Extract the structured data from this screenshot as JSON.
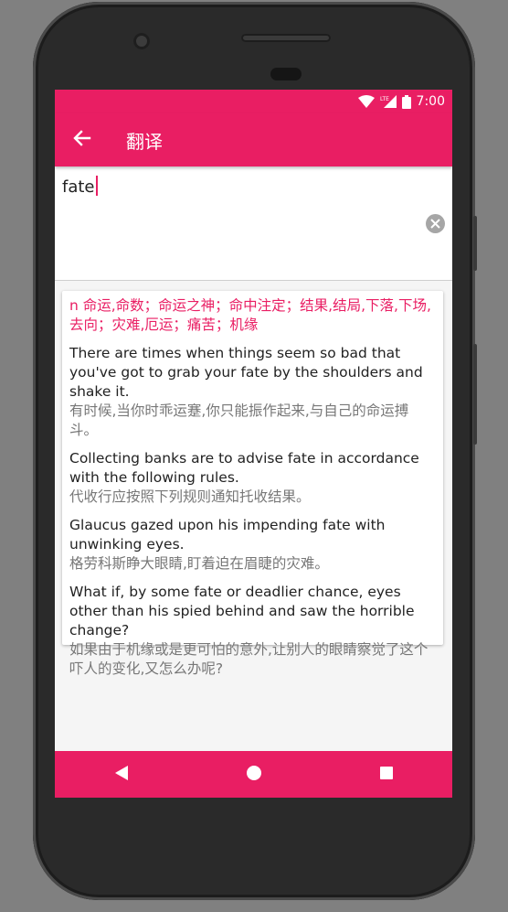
{
  "status_bar": {
    "time": "7:00",
    "icons": [
      "wifi-icon",
      "lte-signal-icon",
      "battery-icon"
    ]
  },
  "app_bar": {
    "title": "翻译",
    "back_icon": "arrow-left-icon"
  },
  "query": {
    "text": "fate",
    "clear_icon": "clear-circle-icon"
  },
  "result": {
    "definition": "n  命运,命数；命运之神；命中注定；结果,结局,下落,下场,去向；灾难,厄运；痛苦；机缘",
    "examples": [
      {
        "en": "There are times when things seem so bad that you've got to grab your fate by the shoulders and shake it.",
        "zh": "有时候,当你时乖运蹇,你只能振作起来,与自己的命运搏斗。"
      },
      {
        "en": "Collecting banks are to advise fate in accordance with the following rules.",
        "zh": "代收行应按照下列规则通知托收结果。"
      },
      {
        "en": "Glaucus gazed upon his impending fate with unwinking eyes.",
        "zh": "格劳科斯睁大眼睛,盯着迫在眉睫的灾难。"
      },
      {
        "en": "What if, by some fate or deadlier chance, eyes other than his spied behind and saw the horrible change?",
        "zh": "如果由于机缘或是更可怕的意外,让别人的眼睛察觉了这个吓人的变化,又怎么办呢?"
      }
    ]
  },
  "nav_bar": {
    "buttons": [
      "back-triangle-icon",
      "home-circle-icon",
      "recents-square-icon"
    ]
  },
  "colors": {
    "accent": "#e91e63",
    "text_primary": "#222222",
    "text_secondary": "#777777"
  }
}
